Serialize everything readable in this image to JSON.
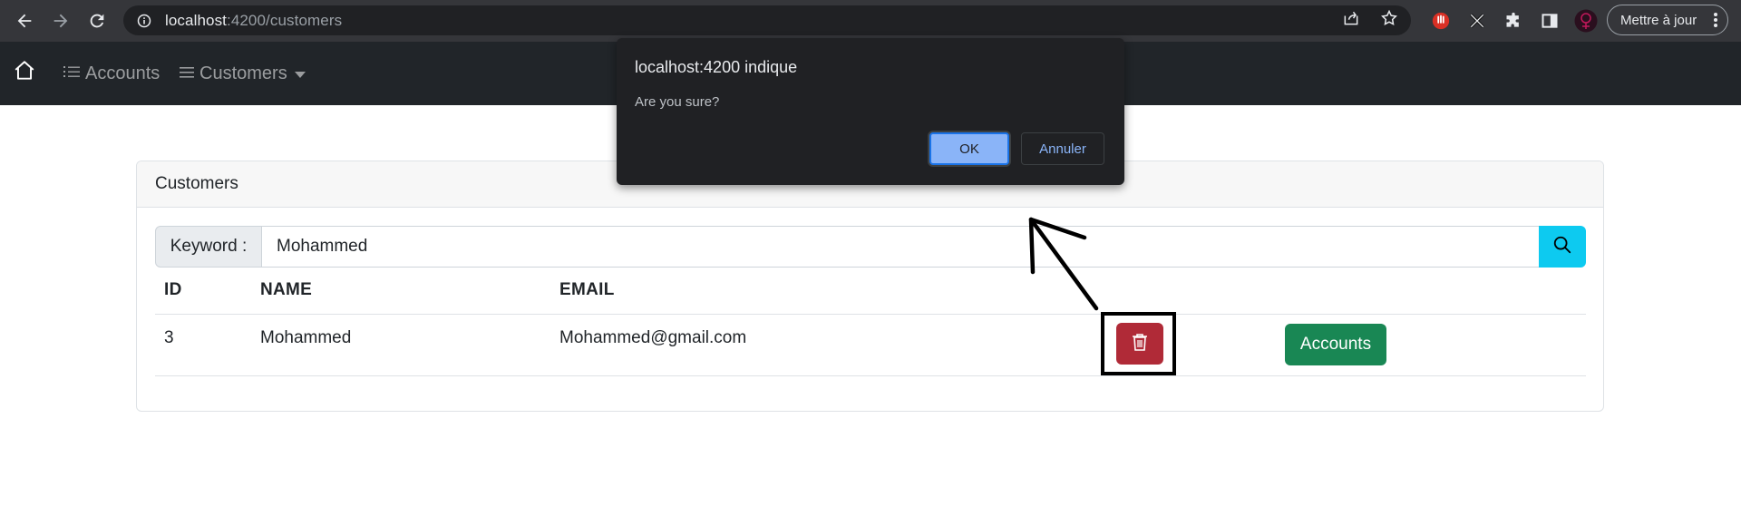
{
  "browser": {
    "url_host": "localhost",
    "url_path": ":4200/customers",
    "update_button_label": "Mettre à jour",
    "icons": [
      "back-icon",
      "forward-icon",
      "reload-icon",
      "site-info-icon",
      "share-icon",
      "bookmark-star-icon",
      "extension-red-icon",
      "extension-x-icon",
      "extensions-puzzle-icon",
      "side-panel-icon",
      "profile-avatar-icon",
      "kebab-menu-icon"
    ]
  },
  "navbar": {
    "home_icon": "house-icon",
    "accounts_label": "Accounts",
    "customers_label": "Customers"
  },
  "card": {
    "header": "Customers",
    "search": {
      "label": "Keyword :",
      "value": "Mohammed"
    },
    "table": {
      "columns": [
        "ID",
        "NAME",
        "EMAIL"
      ],
      "rows": [
        {
          "id": "3",
          "name": "Mohammed",
          "email": "Mohammed@gmail.com",
          "action_label": "Accounts"
        }
      ]
    }
  },
  "dialog": {
    "title": "localhost:4200 indique",
    "message": "Are you sure?",
    "ok_label": "OK",
    "cancel_label": "Annuler"
  },
  "colors": {
    "chrome_bg": "#35363a",
    "navbar_bg": "#212529",
    "search_btn": "#0dcaf0",
    "delete_btn": "#b02a37",
    "accounts_btn": "#198754",
    "dialog_bg": "#202124",
    "dialog_ok": "#8ab4f8"
  }
}
